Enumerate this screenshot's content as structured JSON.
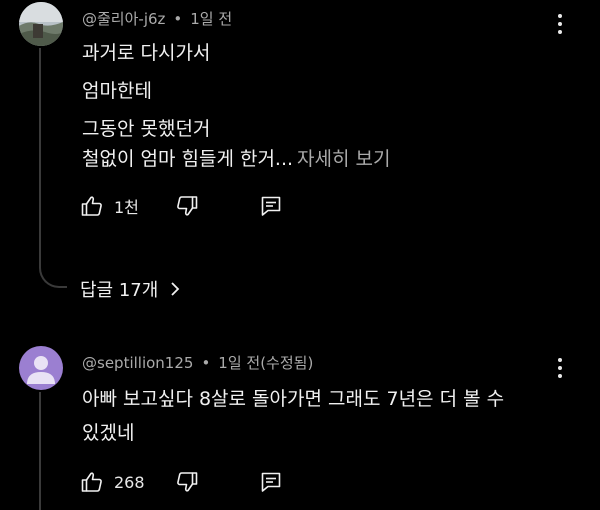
{
  "comments": [
    {
      "author": "@줄리아-j6z",
      "time": "1일 전",
      "lines": [
        "과거로 다시가서",
        "엄마한테",
        "그동안 못했던거",
        "철없이 엄마 힘들게 한거..."
      ],
      "more_label": "자세히 보기",
      "likes": "1천",
      "replies_label": "답글 17개"
    },
    {
      "author": "@septillion125",
      "time": "1일 전(수정됨)",
      "lines": [
        "아빠 보고싶다 8살로 돌아가면 그래도 7년은 더 볼 수",
        "있겠네"
      ],
      "likes": "268"
    }
  ],
  "icons": {
    "like": "thumbs-up-icon",
    "dislike": "thumbs-down-icon",
    "reply": "reply-icon",
    "more": "more-vertical-icon",
    "chevron": "chevron-right-icon"
  },
  "colors": {
    "background": "#000000",
    "text": "#f1f1f1",
    "secondary": "#aaaaaa",
    "avatar2": "#9b7fd1"
  }
}
